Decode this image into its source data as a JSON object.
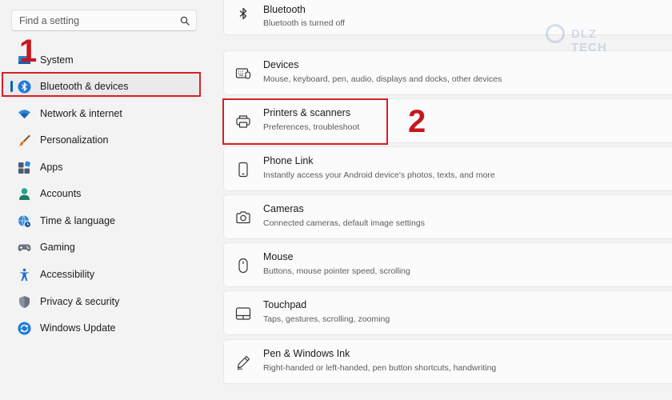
{
  "sidebar": {
    "search": {
      "placeholder": "Find a setting"
    },
    "items": [
      {
        "label": "System",
        "icon": "monitor-icon"
      },
      {
        "label": "Bluetooth & devices",
        "icon": "bluetooth-icon",
        "active": true
      },
      {
        "label": "Network & internet",
        "icon": "wifi-icon"
      },
      {
        "label": "Personalization",
        "icon": "brush-icon"
      },
      {
        "label": "Apps",
        "icon": "apps-icon"
      },
      {
        "label": "Accounts",
        "icon": "person-icon"
      },
      {
        "label": "Time & language",
        "icon": "globe-clock-icon"
      },
      {
        "label": "Gaming",
        "icon": "gamepad-icon"
      },
      {
        "label": "Accessibility",
        "icon": "accessibility-icon"
      },
      {
        "label": "Privacy & security",
        "icon": "shield-icon"
      },
      {
        "label": "Windows Update",
        "icon": "update-icon"
      }
    ]
  },
  "main": {
    "cards": [
      {
        "title": "Bluetooth",
        "desc": "Bluetooth is turned off",
        "icon": "bluetooth-icon"
      },
      {
        "title": "Devices",
        "desc": "Mouse, keyboard, pen, audio, displays and docks, other devices",
        "icon": "devices-icon"
      },
      {
        "title": "Printers & scanners",
        "desc": "Preferences, troubleshoot",
        "icon": "printer-icon"
      },
      {
        "title": "Phone Link",
        "desc": "Instantly access your Android device's photos, texts, and more",
        "icon": "phone-icon"
      },
      {
        "title": "Cameras",
        "desc": "Connected cameras, default image settings",
        "icon": "camera-icon"
      },
      {
        "title": "Mouse",
        "desc": "Buttons, mouse pointer speed, scrolling",
        "icon": "mouse-icon"
      },
      {
        "title": "Touchpad",
        "desc": "Taps, gestures, scrolling, zooming",
        "icon": "touchpad-icon"
      },
      {
        "title": "Pen & Windows Ink",
        "desc": "Right-handed or left-handed, pen button shortcuts, handwriting",
        "icon": "pen-icon"
      }
    ]
  },
  "annotations": {
    "step1": "1",
    "step2": "2"
  },
  "watermark": {
    "text": "DLZ TECH"
  },
  "colors": {
    "accent": "#005fb8",
    "annotation": "#d71f26"
  }
}
